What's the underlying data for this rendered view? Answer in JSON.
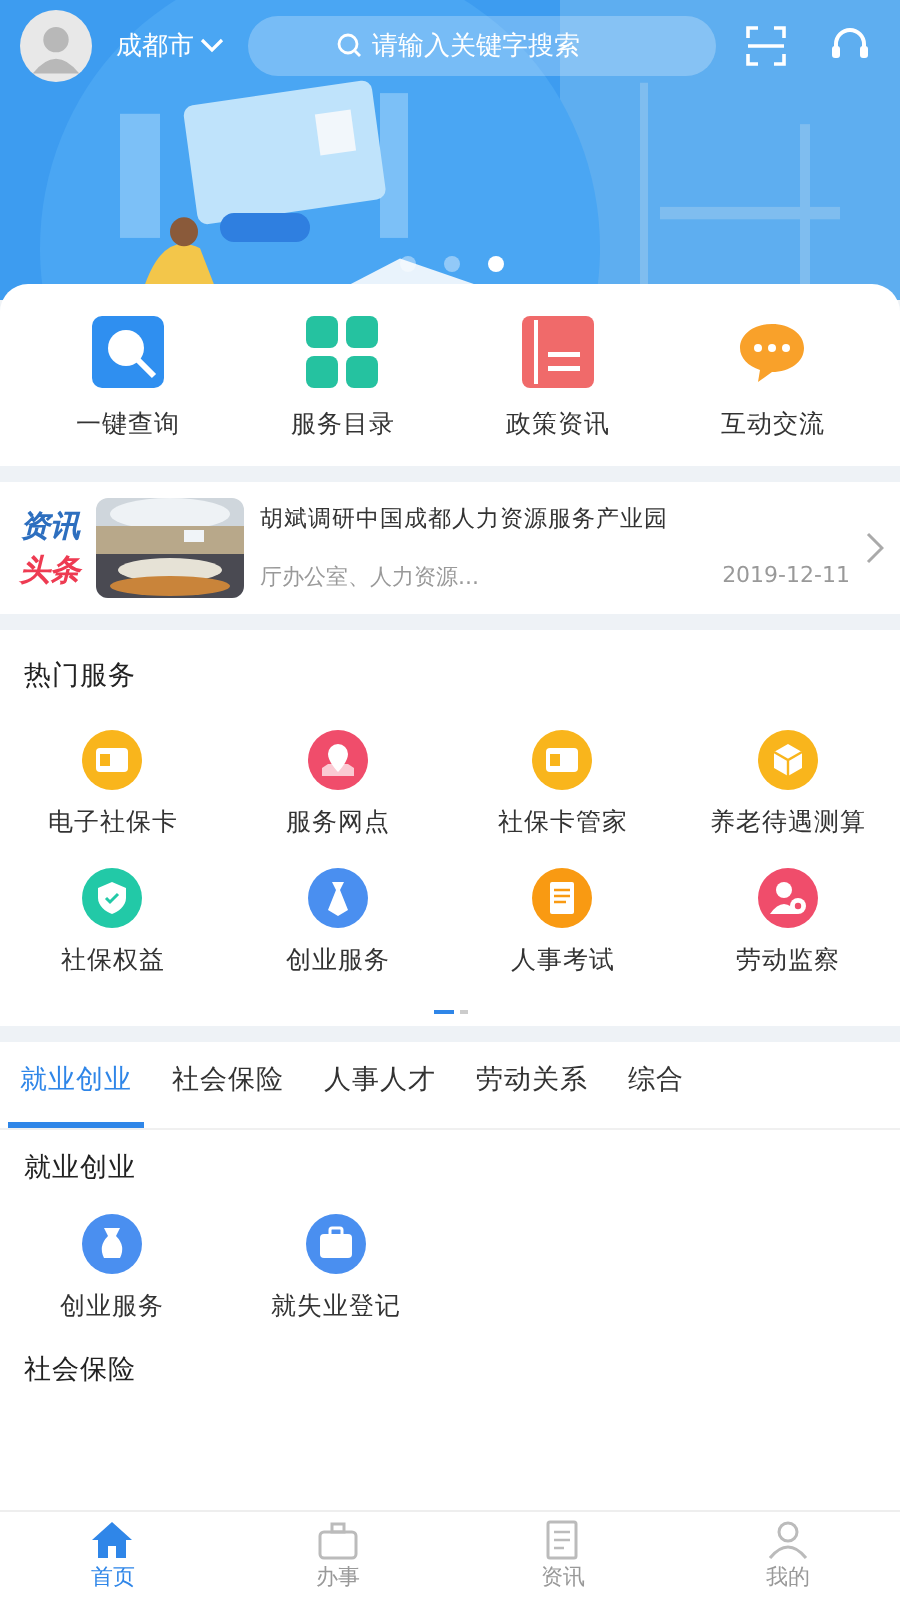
{
  "header": {
    "city": "成都市",
    "search": {
      "placeholder": "请输入关键字搜索"
    }
  },
  "banner": {
    "dots": [
      {
        "selected": false
      },
      {
        "selected": false
      },
      {
        "selected": true
      }
    ]
  },
  "quick_actions": [
    {
      "label": "一键查询",
      "color": "#2f8ff0"
    },
    {
      "label": "服务目录",
      "color": "#25c2a0"
    },
    {
      "label": "政策资讯",
      "color": "#f06a6a"
    },
    {
      "label": "互动交流",
      "color": "#f9a12a"
    }
  ],
  "news": {
    "badge_top": "资讯",
    "badge_bottom": "头条",
    "title": "胡斌调研中国成都人力资源服务产业园",
    "source": "厅办公室、人力资源...",
    "date": "2019-12-11"
  },
  "hot_services": {
    "title": "热门服务",
    "items": [
      {
        "label": "电子社保卡",
        "color": "#f9b51c"
      },
      {
        "label": "服务网点",
        "color": "#f04d6b"
      },
      {
        "label": "社保卡管家",
        "color": "#f9b51c"
      },
      {
        "label": "养老待遇测算",
        "color": "#f9b51c"
      },
      {
        "label": "社保权益",
        "color": "#22c9a7"
      },
      {
        "label": "创业服务",
        "color": "#4a8ff0"
      },
      {
        "label": "人事考试",
        "color": "#f99a12"
      },
      {
        "label": "劳动监察",
        "color": "#f04d6b"
      }
    ],
    "pages": [
      {
        "selected": true
      },
      {
        "selected": false
      }
    ]
  },
  "tabs": [
    {
      "label": "就业创业",
      "selected": true
    },
    {
      "label": "社会保险",
      "selected": false
    },
    {
      "label": "人事人才",
      "selected": false
    },
    {
      "label": "劳动关系",
      "selected": false
    },
    {
      "label": "综合",
      "selected": false
    }
  ],
  "section": {
    "title": "就业创业",
    "items": [
      {
        "label": "创业服务",
        "color": "#4a8ff0"
      },
      {
        "label": "就失业登记",
        "color": "#4a8ff0"
      }
    ]
  },
  "next_section": {
    "title": "社会保险"
  },
  "bottom_nav": [
    {
      "label": "首页",
      "selected": true
    },
    {
      "label": "办事",
      "selected": false
    },
    {
      "label": "资讯",
      "selected": false
    },
    {
      "label": "我的",
      "selected": false
    }
  ]
}
